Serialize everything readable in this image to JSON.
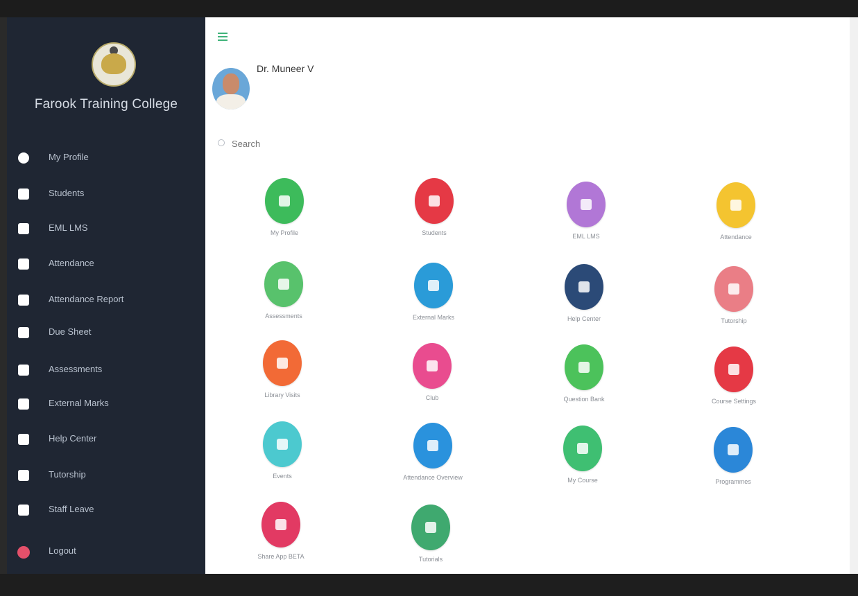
{
  "sidebar": {
    "college_name": "Farook Training College",
    "items": [
      {
        "label": "My Profile",
        "icon": "user-circle-icon"
      },
      {
        "label": "Students",
        "icon": "users-icon"
      },
      {
        "label": "EML LMS",
        "icon": "lms-icon"
      },
      {
        "label": "Attendance",
        "icon": "clipboard-check-icon"
      },
      {
        "label": "Attendance Report",
        "icon": "report-icon"
      },
      {
        "label": "Due Sheet",
        "icon": "sheet-icon"
      },
      {
        "label": "Assessments",
        "icon": "chart-icon"
      },
      {
        "label": "External Marks",
        "icon": "marks-icon"
      },
      {
        "label": "Help Center",
        "icon": "help-book-icon"
      },
      {
        "label": "Tutorship",
        "icon": "users-group-icon"
      },
      {
        "label": "Staff Leave",
        "icon": "id-badge-icon"
      }
    ],
    "logout_label": "Logout"
  },
  "header": {
    "menu_icon": "hamburger-icon",
    "profile_name": "Dr. Muneer V"
  },
  "search": {
    "placeholder": "Search"
  },
  "tiles": [
    {
      "label": "My Profile",
      "color": "#3dbb5b",
      "icon": "user-circle-icon"
    },
    {
      "label": "Students",
      "color": "#e53945",
      "icon": "students-icon"
    },
    {
      "label": "EML LMS",
      "color": "#b177d6",
      "icon": "lms-icon"
    },
    {
      "label": "Attendance",
      "color": "#f4c430",
      "icon": "clipboard-check-icon"
    },
    {
      "label": "Assessments",
      "color": "#58c26c",
      "icon": "chart-icon"
    },
    {
      "label": "External Marks",
      "color": "#2a9bd8",
      "icon": "marks-icon"
    },
    {
      "label": "Help Center",
      "color": "#2b4a77",
      "icon": "help-book-icon"
    },
    {
      "label": "Tutorship",
      "color": "#ea7e86",
      "icon": "tutorship-icon"
    },
    {
      "label": "Library Visits",
      "color": "#f26a36",
      "icon": "library-icon"
    },
    {
      "label": "Club",
      "color": "#e94c8f",
      "icon": "club-icon"
    },
    {
      "label": "Question Bank",
      "color": "#4cc25b",
      "icon": "question-bank-icon"
    },
    {
      "label": "Course Settings",
      "color": "#e53945",
      "icon": "course-settings-icon"
    },
    {
      "label": "Events",
      "color": "#4cc9cf",
      "icon": "events-icon"
    },
    {
      "label": "Attendance Overview",
      "color": "#2a92dd",
      "icon": "overview-icon"
    },
    {
      "label": "My Course",
      "color": "#3fbf72",
      "icon": "course-icon"
    },
    {
      "label": "Programmes",
      "color": "#2b87d8",
      "icon": "programmes-icon"
    },
    {
      "label": "Share App BETA",
      "color": "#e23a63",
      "icon": "share-app-icon"
    },
    {
      "label": "Tutorials",
      "color": "#3fa96f",
      "icon": "tutorials-icon"
    }
  ]
}
